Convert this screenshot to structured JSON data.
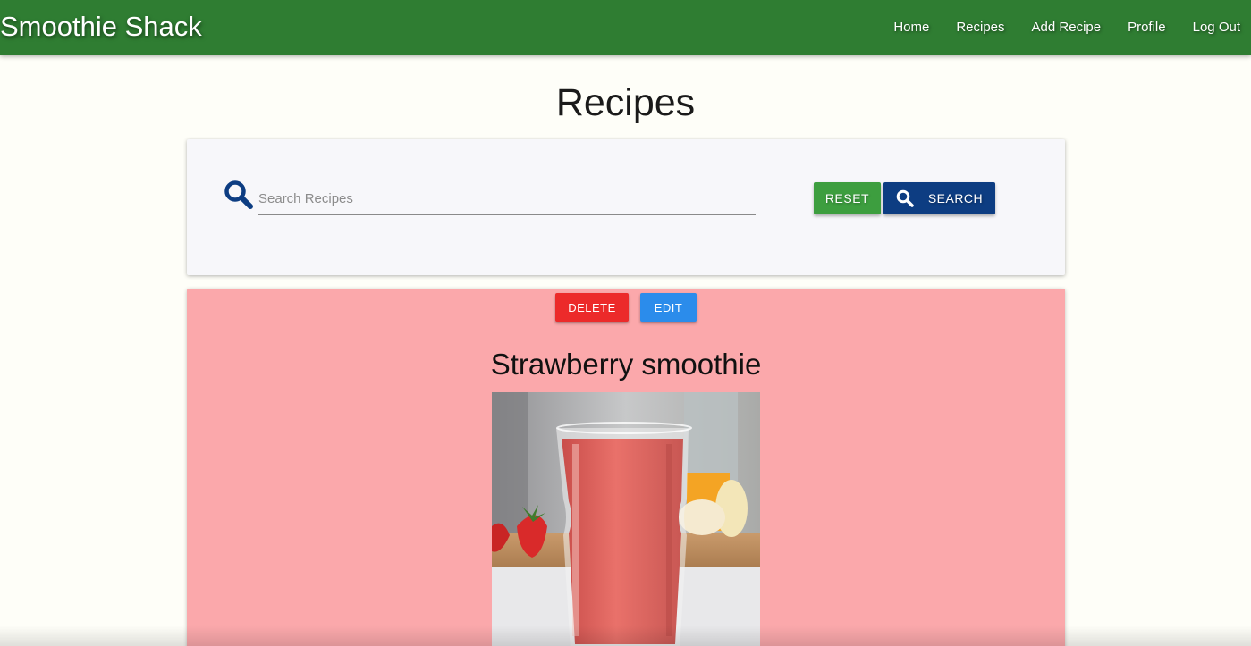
{
  "navbar": {
    "brand": "Smoothie Shack",
    "links": [
      "Home",
      "Recipes",
      "Add Recipe",
      "Profile",
      "Log Out"
    ],
    "background": "#2f7d32"
  },
  "page": {
    "title": "Recipes"
  },
  "search": {
    "placeholder": "Search Recipes",
    "value": "",
    "reset_label": "RESET",
    "search_label": "SEARCH",
    "reset_color": "#3d9e3f",
    "search_color": "#0d3d82"
  },
  "recipe": {
    "delete_label": "DELETE",
    "edit_label": "EDIT",
    "title": "Strawberry smoothie",
    "image_icon": "strawberry-smoothie-photo",
    "card_color": "#fba8ab",
    "delete_color": "#ec2a2a",
    "edit_color": "#2b8ceb"
  }
}
